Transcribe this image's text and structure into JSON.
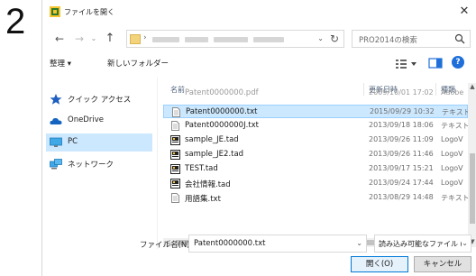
{
  "step_number": "2",
  "window": {
    "title": "ファイルを開く",
    "close_glyph": "✕"
  },
  "nav": {
    "back_glyph": "←",
    "forward_glyph": "→",
    "history_glyph": "⌄",
    "up_glyph": "↑"
  },
  "address": {
    "chevron": "›",
    "dropdown_glyph": "⌄",
    "refresh_glyph": "↻"
  },
  "search": {
    "placeholder": "PRO2014の検索"
  },
  "toolbar": {
    "organize_label": "整理 ▾",
    "new_folder_label": "新しいフォルダー",
    "help_glyph": "?"
  },
  "navpane": {
    "items": [
      {
        "label": "クイック アクセス",
        "icon": "star-icon"
      },
      {
        "label": "OneDrive",
        "icon": "cloud-icon"
      },
      {
        "label": "PC",
        "icon": "monitor-icon"
      },
      {
        "label": "ネットワーク",
        "icon": "network-icon"
      }
    ]
  },
  "list": {
    "columns": {
      "name": "名前",
      "modified": "更新日時",
      "type": "種類"
    },
    "sort_glyph": "^",
    "files": [
      {
        "name": "Patent0000000.pdf",
        "modified": "2009/10/01 17:02",
        "type": "Adobe",
        "icon": "pdf-file-icon",
        "partial": true
      },
      {
        "name": "Patent0000000.txt",
        "modified": "2015/09/29 10:32",
        "type": "テキスト",
        "icon": "text-file-icon",
        "selected": true
      },
      {
        "name": "Patent0000000J.txt",
        "modified": "2013/09/18 18:06",
        "type": "テキスト",
        "icon": "text-file-icon"
      },
      {
        "name": "sample_JE.tad",
        "modified": "2013/09/26 11:09",
        "type": "LogoV",
        "icon": "tad-file-icon"
      },
      {
        "name": "sample_JE2.tad",
        "modified": "2013/09/26 11:46",
        "type": "LogoV",
        "icon": "tad-file-icon"
      },
      {
        "name": "TEST.tad",
        "modified": "2013/09/17 15:21",
        "type": "LogoV",
        "icon": "tad-file-icon"
      },
      {
        "name": "会社情報.tad",
        "modified": "2013/09/24 17:44",
        "type": "LogoV",
        "icon": "tad-file-icon"
      },
      {
        "name": "用語集.txt",
        "modified": "2013/08/29 14:48",
        "type": "テキスト",
        "icon": "text-file-icon"
      }
    ]
  },
  "scroll": {
    "up_glyph": "▲",
    "down_glyph": "▼",
    "left_glyph": "<",
    "right_glyph": ">"
  },
  "filename": {
    "label": "ファイル名(N):",
    "value": "Patent0000000.txt",
    "dropdown_glyph": "⌄"
  },
  "filetype": {
    "value": "読み込み可能なファイル (*.tad;*.w",
    "dropdown_glyph": "⌄"
  },
  "buttons": {
    "open_label": "開く(O)",
    "cancel_label": "キャンセル"
  },
  "colors": {
    "selection": "#cce8ff",
    "selection_border": "#99d1ff",
    "accent": "#0078d7",
    "header_text": "#4c607a"
  }
}
